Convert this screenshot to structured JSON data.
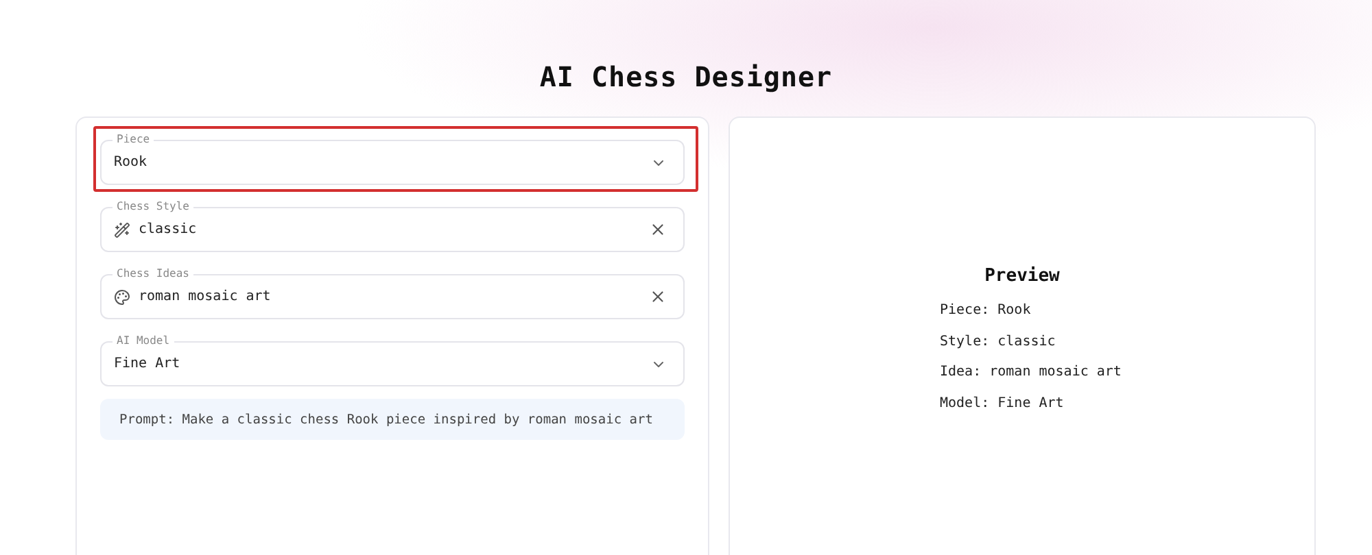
{
  "title": "AI Chess Designer",
  "fields": [
    {
      "kind": "select",
      "label": "Piece",
      "value": "Rook",
      "highlighted": true
    },
    {
      "kind": "text",
      "label": "Chess Style",
      "value": "classic",
      "highlighted": false
    },
    {
      "kind": "text",
      "label": "Chess Ideas",
      "value": "roman mosaic art",
      "highlighted": false
    },
    {
      "kind": "select",
      "label": "AI Model",
      "value": "Fine Art",
      "highlighted": false
    }
  ],
  "prompt": "Prompt: Make a classic chess Rook piece inspired by roman mosaic art",
  "preview": {
    "title": "Preview",
    "lines": [
      "Piece: Rook",
      "Style: classic",
      "Idea: roman mosaic art",
      "Model: Fine Art"
    ]
  }
}
